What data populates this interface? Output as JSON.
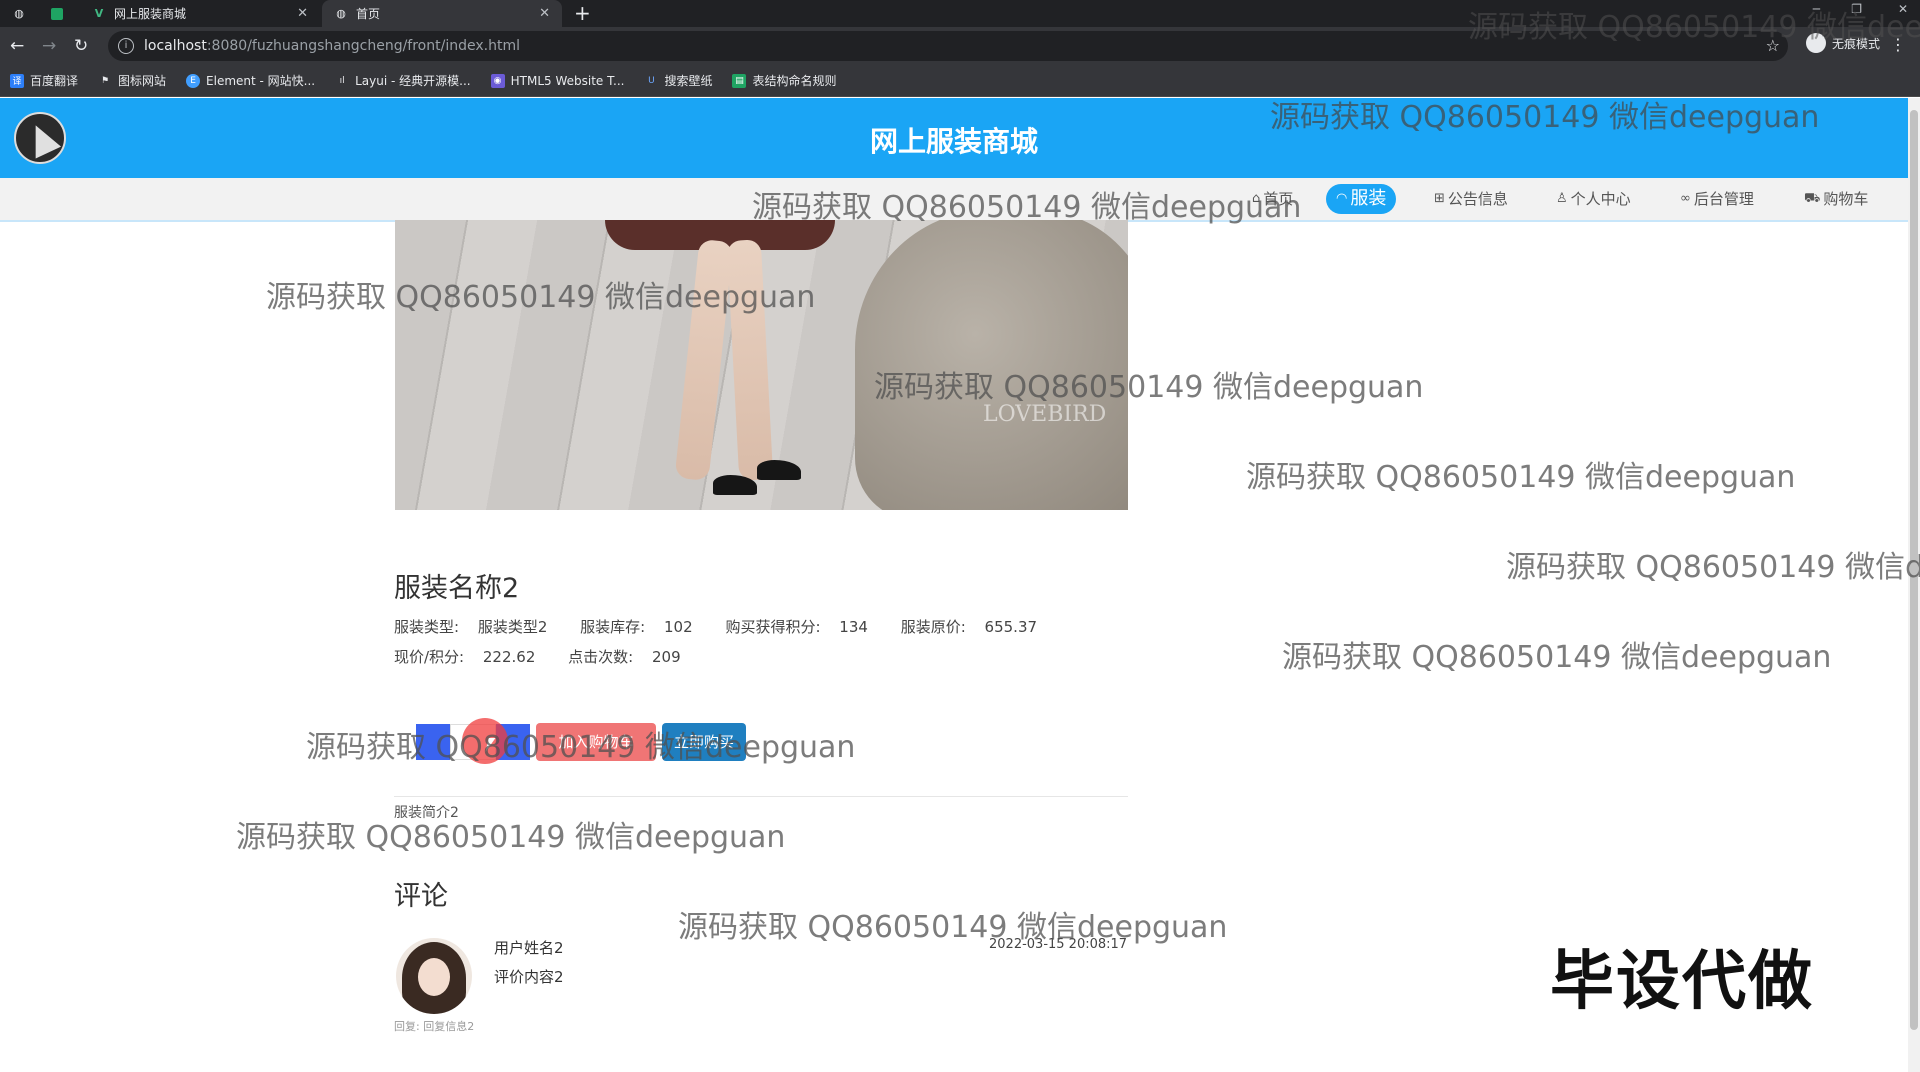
{
  "browser": {
    "tabs": [
      {
        "label": "网上服装商城"
      },
      {
        "label": "首页"
      }
    ],
    "new_tab": "+",
    "url_host": "localhost",
    "url_path": ":8080/fuzhuangshangcheng/front/index.html",
    "profile_label": "无痕模式",
    "bookmarks": [
      {
        "label": "百度翻译",
        "color": "#2d7ff9"
      },
      {
        "label": "图标网站",
        "color": "#222222"
      },
      {
        "label": "Element - 网站快...",
        "color": "#409eff"
      },
      {
        "label": "Layui - 经典开源模...",
        "color": "#555555"
      },
      {
        "label": "HTML5 Website T...",
        "color": "#6b5bd6"
      },
      {
        "label": "搜索壁纸",
        "color": "#2a6fd6"
      },
      {
        "label": "表结构命名规则",
        "color": "#1fa463"
      }
    ]
  },
  "site": {
    "title": "网上服装商城",
    "accent_color": "#1aa5f5",
    "nav": [
      {
        "label": "首页",
        "icon": "home-icon"
      },
      {
        "label": "服装",
        "icon": "shirt-icon",
        "active": true
      },
      {
        "label": "公告信息",
        "icon": "notice-icon"
      },
      {
        "label": "个人中心",
        "icon": "user-icon"
      },
      {
        "label": "后台管理",
        "icon": "link-icon"
      },
      {
        "label": "购物车",
        "icon": "cart-icon"
      }
    ]
  },
  "product": {
    "photo_watermark": "LOVEBIRD",
    "name": "服装名称2",
    "line1": [
      {
        "label": "服装类型:",
        "value": "服装类型2"
      },
      {
        "label": "服装库存:",
        "value": "102"
      },
      {
        "label": "购买获得积分:",
        "value": "134"
      },
      {
        "label": "服装原价:",
        "value": "655.37"
      }
    ],
    "line2": [
      {
        "label": "现价/积分:",
        "value": "222.62"
      },
      {
        "label": "点击次数:",
        "value": "209"
      }
    ],
    "add_to_cart": "加入购物车",
    "buy_now": "立即购买",
    "description": "服装简介2"
  },
  "comments": {
    "title": "评论",
    "items": [
      {
        "user": "用户姓名2",
        "content": "评价内容2",
        "time": "2022-03-15 20:08:17",
        "reply": "回复: 回复信息2"
      }
    ]
  },
  "overlay": {
    "watermark": "源码获取 QQ86050149 微信deepguan",
    "stamp": "毕设代做"
  }
}
